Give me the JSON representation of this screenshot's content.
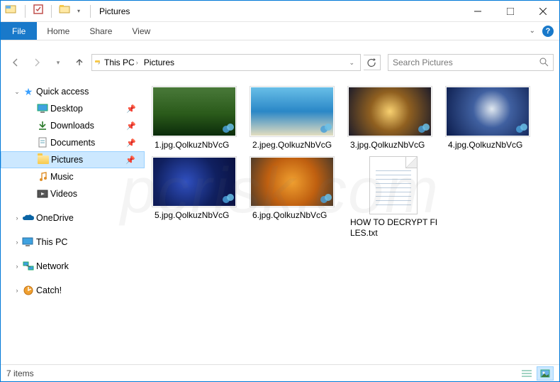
{
  "window": {
    "title": "Pictures"
  },
  "ribbon": {
    "file": "File",
    "tabs": [
      "Home",
      "Share",
      "View"
    ]
  },
  "breadcrumb": {
    "items": [
      "This PC",
      "Pictures"
    ]
  },
  "search": {
    "placeholder": "Search Pictures"
  },
  "nav": {
    "quick_access": {
      "label": "Quick access",
      "items": [
        {
          "label": "Desktop",
          "pinned": true
        },
        {
          "label": "Downloads",
          "pinned": true
        },
        {
          "label": "Documents",
          "pinned": true
        },
        {
          "label": "Pictures",
          "pinned": true,
          "selected": true
        },
        {
          "label": "Music",
          "pinned": false
        },
        {
          "label": "Videos",
          "pinned": false
        }
      ]
    },
    "roots": [
      {
        "label": "OneDrive",
        "icon": "onedrive"
      },
      {
        "label": "This PC",
        "icon": "pc"
      },
      {
        "label": "Network",
        "icon": "network"
      },
      {
        "label": "Catch!",
        "icon": "catch"
      }
    ]
  },
  "files": [
    {
      "name": "1.jpg.QolkuzNbVcG",
      "thumb": "img1"
    },
    {
      "name": "2.jpeg.QolkuzNbVcG",
      "thumb": "img2"
    },
    {
      "name": "3.jpg.QolkuzNbVcG",
      "thumb": "img3"
    },
    {
      "name": "4.jpg.QolkuzNbVcG",
      "thumb": "img4"
    },
    {
      "name": "5.jpg.QolkuzNbVcG",
      "thumb": "img5"
    },
    {
      "name": "6.jpg.QolkuzNbVcG",
      "thumb": "img6"
    },
    {
      "name": "HOW TO DECRYPT FILES.txt",
      "thumb": "txt"
    }
  ],
  "status": {
    "count": "7 items"
  },
  "watermark": "pcrisk.com"
}
